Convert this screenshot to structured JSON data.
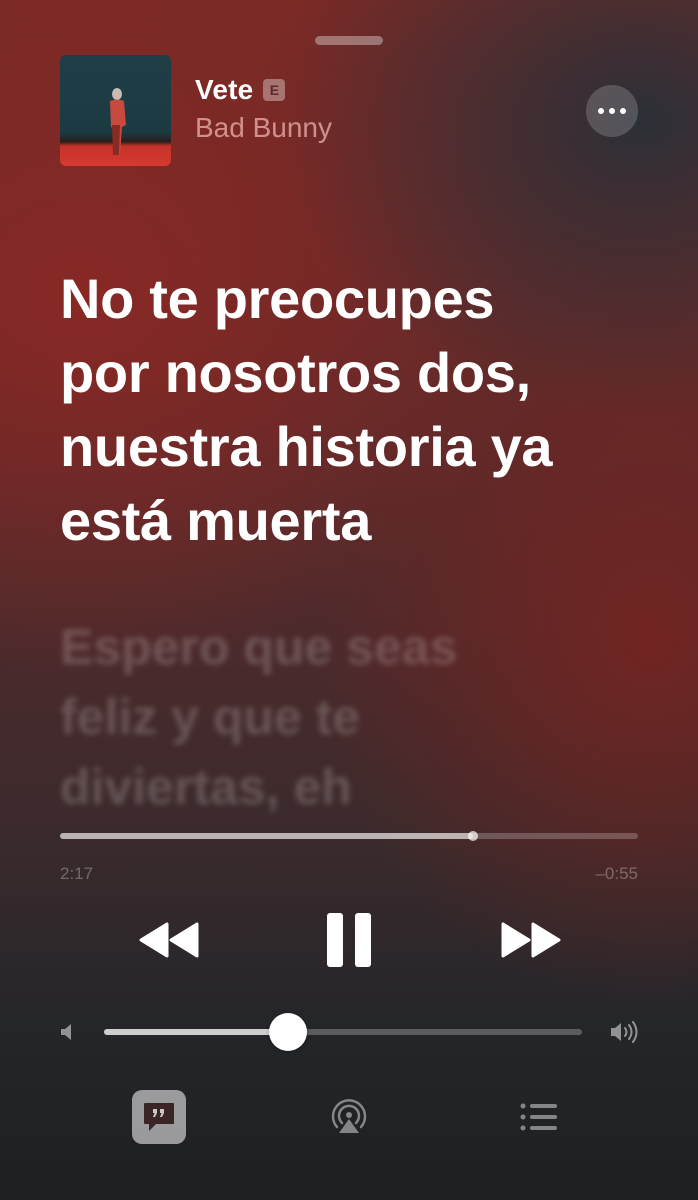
{
  "track": {
    "title": "Vete",
    "explicit_badge": "E",
    "artist": "Bad Bunny"
  },
  "lyrics": {
    "active_lines": [
      "No te preocupes",
      "por nosotros dos,",
      "nuestra historia ya",
      "está muerta"
    ],
    "next_lines": [
      "Espero que seas",
      "feliz y que te",
      "diviertas, eh"
    ]
  },
  "playback": {
    "elapsed": "2:17",
    "remaining": "–0:55",
    "progress_fraction": 0.714,
    "state": "playing"
  },
  "volume": {
    "level_fraction": 0.385
  },
  "icons": {
    "more": "ellipsis-icon",
    "rewind": "rewind-icon",
    "pause": "pause-icon",
    "forward": "fast-forward-icon",
    "volume_low": "speaker-low-icon",
    "volume_high": "speaker-high-icon",
    "lyrics": "lyrics-quote-icon",
    "airplay": "airplay-icon",
    "queue": "queue-list-icon"
  }
}
